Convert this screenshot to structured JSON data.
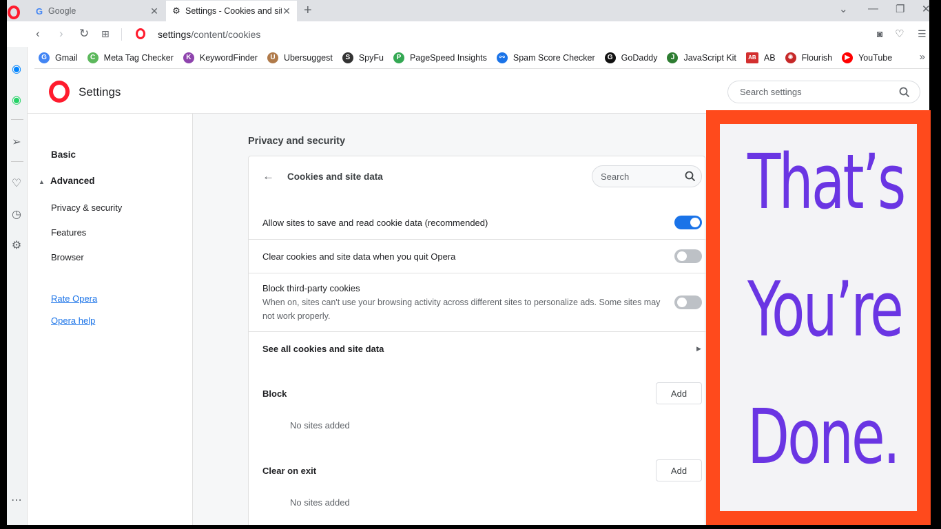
{
  "tabs": [
    {
      "title": "Google",
      "favicon": "G"
    },
    {
      "title": "Settings - Cookies and site"
    }
  ],
  "address": {
    "host": "settings",
    "path": "/content/cookies"
  },
  "bookmarks": [
    {
      "label": "Gmail",
      "icon": "G",
      "color": "#4285f4"
    },
    {
      "label": "Meta Tag Checker",
      "icon": "C",
      "color": "#5cb85c"
    },
    {
      "label": "KeywordFinder",
      "icon": "K",
      "color": "#8e44ad"
    },
    {
      "label": "Ubersuggest",
      "icon": "U",
      "color": "#b07a4a"
    },
    {
      "label": "SpyFu",
      "icon": "S",
      "color": "#333333"
    },
    {
      "label": "PageSpeed Insights",
      "icon": "P",
      "color": "#34a853"
    },
    {
      "label": "Spam Score Checker",
      "icon": "⚯",
      "color": "#1a73e8"
    },
    {
      "label": "GoDaddy",
      "icon": "G",
      "color": "#111111"
    },
    {
      "label": "JavaScript Kit",
      "icon": "J",
      "color": "#2e7d32"
    },
    {
      "label": "AB",
      "icon": "AB",
      "color": "#d32f2f"
    },
    {
      "label": "Flourish",
      "icon": "✺",
      "color": "#c62828"
    },
    {
      "label": "YouTube",
      "icon": "▶",
      "color": "#ff0000"
    }
  ],
  "settings": {
    "title": "Settings",
    "search_placeholder": "Search settings"
  },
  "nav": {
    "basic": "Basic",
    "advanced": "Advanced",
    "privacy": "Privacy & security",
    "features": "Features",
    "browser": "Browser",
    "rate": "Rate Opera",
    "help": "Opera help"
  },
  "main": {
    "section_title": "Privacy and security",
    "card_title": "Cookies and site data",
    "search_placeholder": "Search",
    "allow_label": "Allow sites to save and read cookie data (recommended)",
    "allow_on": true,
    "clear_label": "Clear cookies and site data when you quit Opera",
    "clear_on": false,
    "block3p_label": "Block third-party cookies",
    "block3p_desc": "When on, sites can't use your browsing activity across different sites to personalize ads. Some sites may not work properly.",
    "block3p_on": false,
    "see_all": "See all cookies and site data",
    "block_label": "Block",
    "clear_exit_label": "Clear on exit",
    "add": "Add",
    "no_sites": "No sites added"
  },
  "overlay": {
    "lines": [
      "That’s",
      "You’re",
      "Done."
    ],
    "border_color": "#ff4a1c",
    "text_color": "#6a35e3"
  }
}
